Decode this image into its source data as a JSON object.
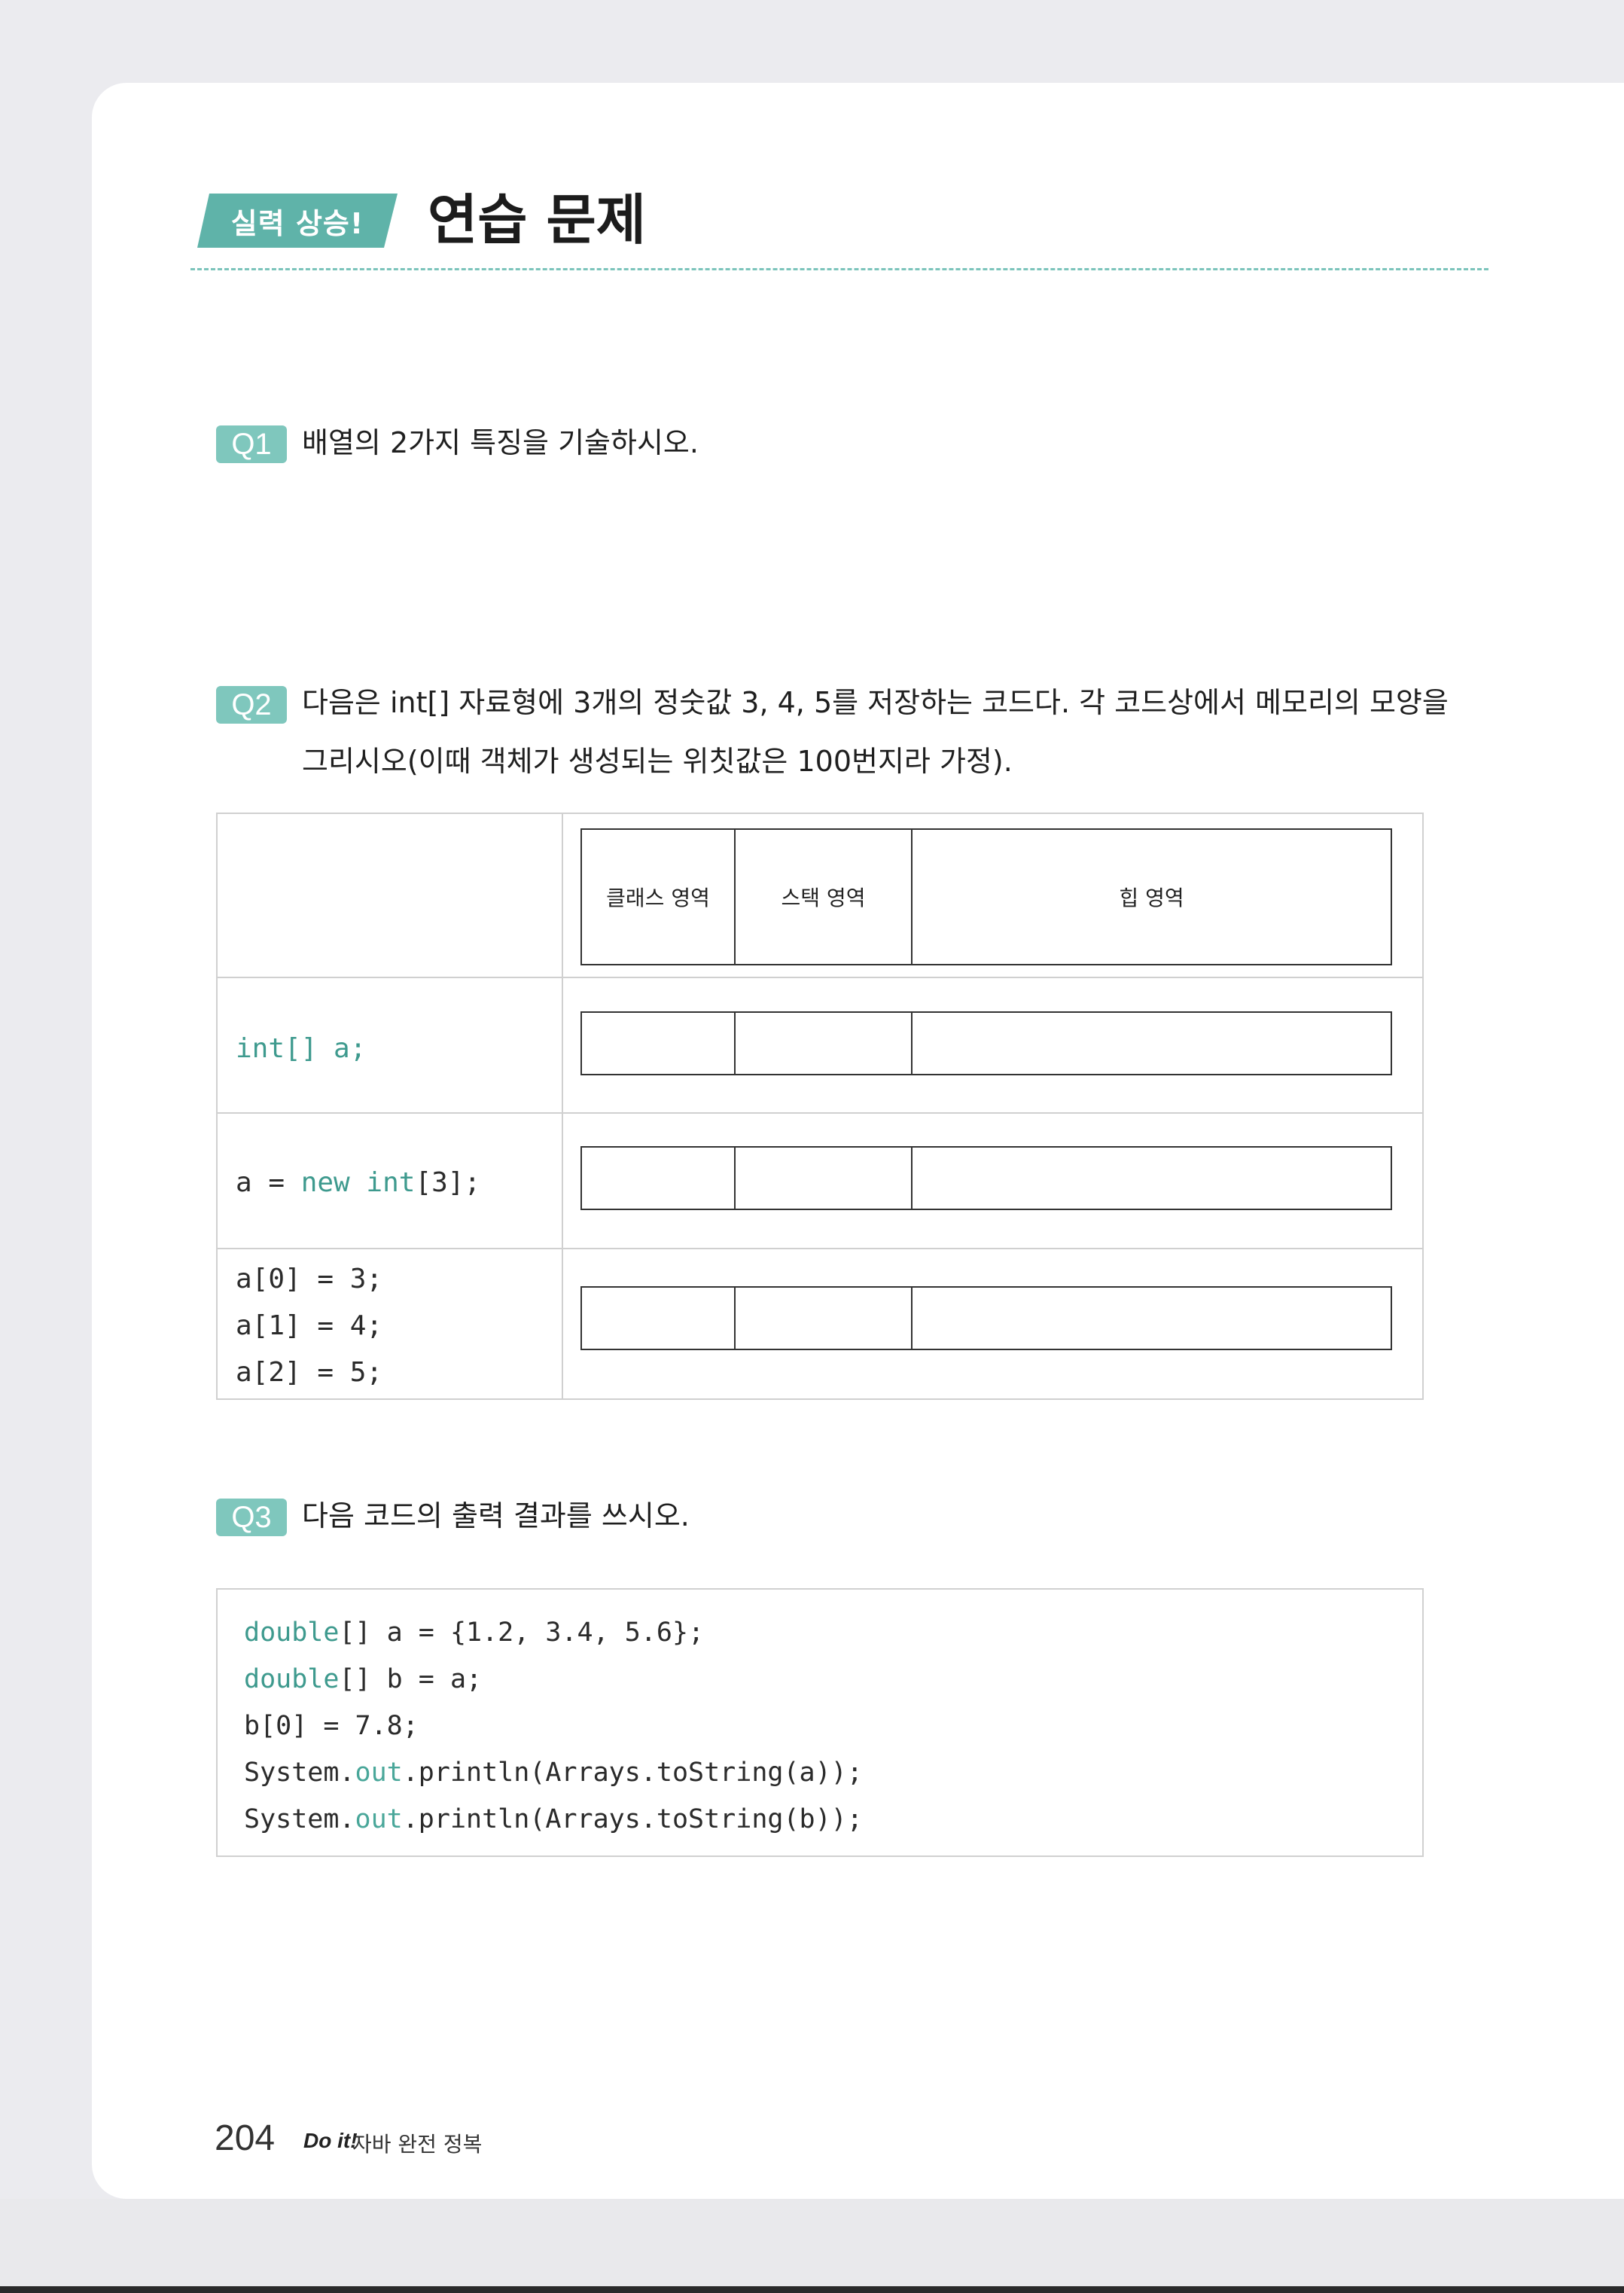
{
  "header": {
    "badge": "실력 상승!",
    "title": "연습 문제"
  },
  "q1": {
    "label": "Q1",
    "text": "배열의 2가지 특징을 기술하시오."
  },
  "q2": {
    "label": "Q2",
    "text_line1": "다음은 int[] 자료형에 3개의 정숫값 3, 4, 5를 저장하는 코드다. 각 코드상에서 메모리의 모양을",
    "text_line2": "그리시오(이때 객체가 생성되는 위칫값은 100번지라 가정).",
    "memory_headers": [
      "클래스 영역",
      "스택 영역",
      "힙 영역"
    ],
    "rows": [
      [
        "int[] a;"
      ],
      [
        "a = new int[3];"
      ],
      [
        "a[0] = 3;",
        "a[1] = 4;",
        "a[2] = 5;"
      ]
    ]
  },
  "q3": {
    "label": "Q3",
    "text": "다음 코드의 출력 결과를 쓰시오.",
    "code": [
      "double[] a = {1.2, 3.4, 5.6};",
      "double[] b = a;",
      "b[0] = 7.8;",
      "System.out.println(Arrays.toString(a));",
      "System.out.println(Arrays.toString(b));"
    ]
  },
  "footer": {
    "page_number": "204",
    "brand": "Do it!",
    "book_title": "자바 완전 정복"
  },
  "colors": {
    "accent": "#5fb3a9",
    "badge": "#7fc7bd",
    "keyword": "#3e9a8e"
  }
}
